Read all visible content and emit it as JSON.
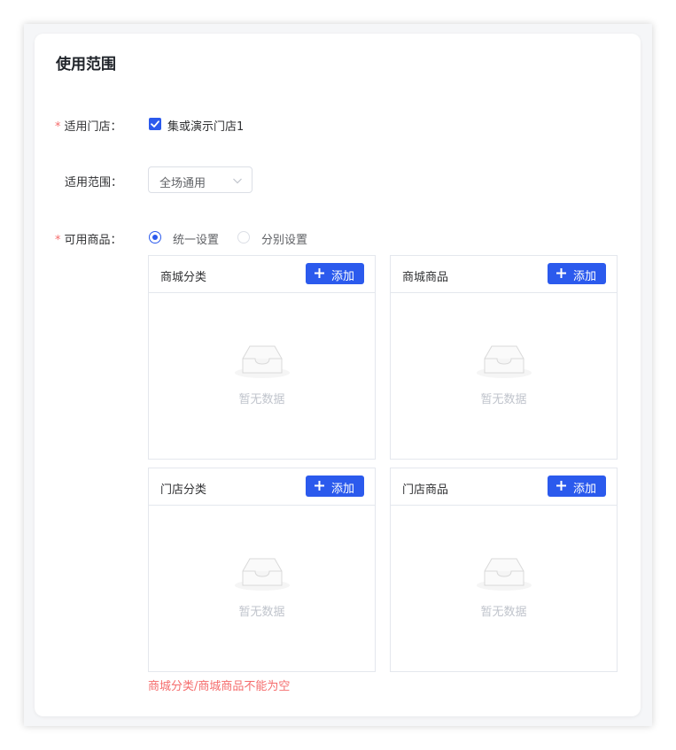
{
  "section": {
    "title": "使用范围"
  },
  "store": {
    "label": "适用门店：",
    "required_mark": "*",
    "checkbox_label": "集或演示门店1",
    "checked": true
  },
  "scope": {
    "label": "适用范围：",
    "selected": "全场通用"
  },
  "products": {
    "label": "可用商品：",
    "required_mark": "*",
    "radio_options": [
      "统一设置",
      "分别设置"
    ],
    "selected_option": "统一设置"
  },
  "panels": [
    {
      "title": "商城分类",
      "add_label": "添加",
      "empty_text": "暂无数据"
    },
    {
      "title": "商城商品",
      "add_label": "添加",
      "empty_text": "暂无数据"
    },
    {
      "title": "门店分类",
      "add_label": "添加",
      "empty_text": "暂无数据"
    },
    {
      "title": "门店商品",
      "add_label": "添加",
      "empty_text": "暂无数据"
    }
  ],
  "error_message": "商城分类/商城商品不能为空",
  "colors": {
    "primary": "#2b5aed",
    "error": "#f56c6c",
    "border": "#e4e7ed"
  }
}
